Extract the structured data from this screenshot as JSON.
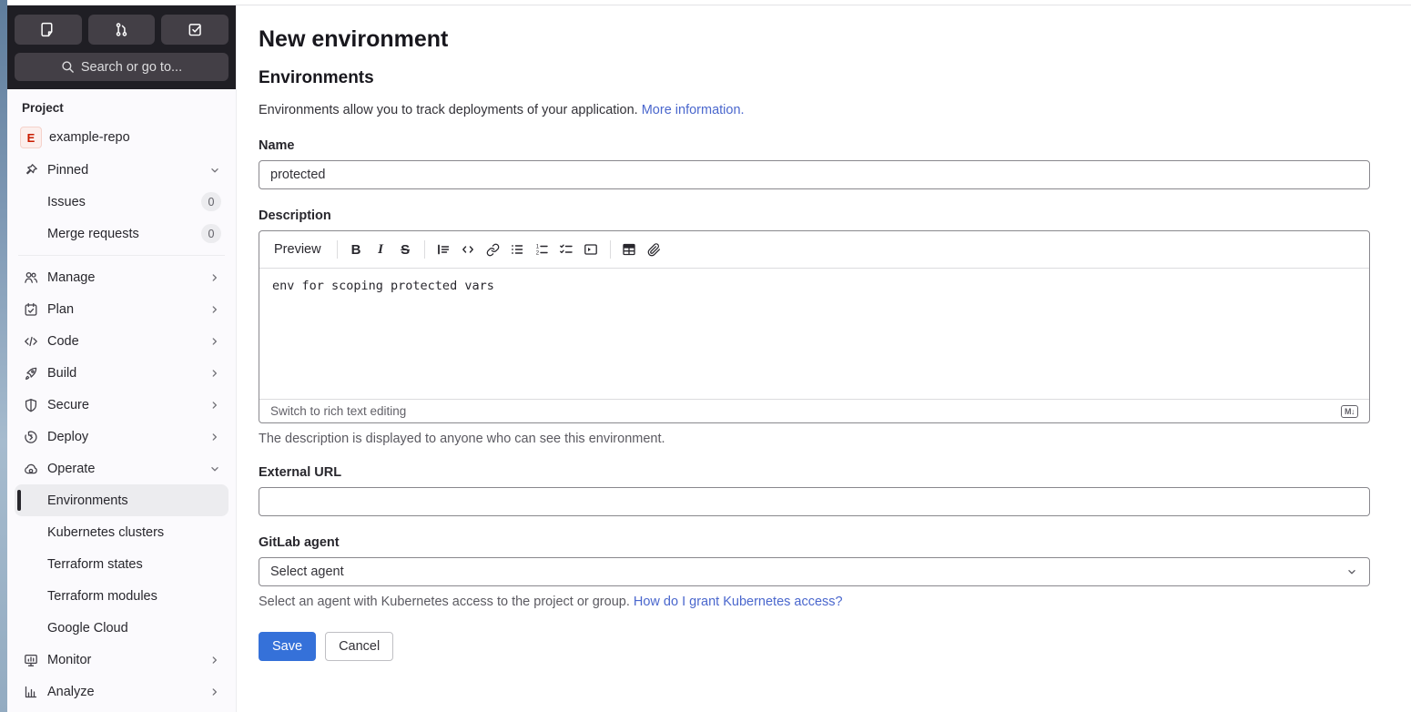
{
  "sidebar": {
    "search_placeholder": "Search or go to...",
    "section_label": "Project",
    "project": {
      "avatar_letter": "E",
      "name": "example-repo"
    },
    "top_icons": [
      "issues-icon",
      "merge-request-icon",
      "todo-icon"
    ],
    "items": [
      {
        "label": "Pinned"
      },
      {
        "label": "Issues",
        "badge": "0"
      },
      {
        "label": "Merge requests",
        "badge": "0"
      },
      {
        "label": "Manage"
      },
      {
        "label": "Plan"
      },
      {
        "label": "Code"
      },
      {
        "label": "Build"
      },
      {
        "label": "Secure"
      },
      {
        "label": "Deploy"
      },
      {
        "label": "Operate"
      },
      {
        "label": "Environments"
      },
      {
        "label": "Kubernetes clusters"
      },
      {
        "label": "Terraform states"
      },
      {
        "label": "Terraform modules"
      },
      {
        "label": "Google Cloud"
      },
      {
        "label": "Monitor"
      },
      {
        "label": "Analyze"
      }
    ]
  },
  "main": {
    "title": "New environment",
    "section_title": "Environments",
    "intro_text": "Environments allow you to track deployments of your application.",
    "intro_link": "More information.",
    "name_field": {
      "label": "Name",
      "value": "protected"
    },
    "description_field": {
      "label": "Description",
      "preview_label": "Preview",
      "toolbar_glyphs": {
        "bold": "B",
        "italic": "I",
        "strike": "S"
      },
      "value": "env for scoping protected vars",
      "footer_link": "Switch to rich text editing",
      "markdown_badge": "M↓",
      "help_text": "The description is displayed to anyone who can see this environment."
    },
    "external_url_field": {
      "label": "External URL",
      "value": ""
    },
    "agent_field": {
      "label": "GitLab agent",
      "selected": "Select agent",
      "help_text": "Select an agent with Kubernetes access to the project or group. ",
      "help_link": "How do I grant Kubernetes access?"
    },
    "save_label": "Save",
    "cancel_label": "Cancel"
  },
  "colors": {
    "primary_button": "#3571d9",
    "link": "#4a67cd",
    "sidebar_header_bg": "#1f1e24",
    "sidebar_bg": "#fbfafd",
    "selected_item_bg": "#ececef",
    "avatar_bg": "#fcefed",
    "avatar_text": "#c91c00"
  }
}
